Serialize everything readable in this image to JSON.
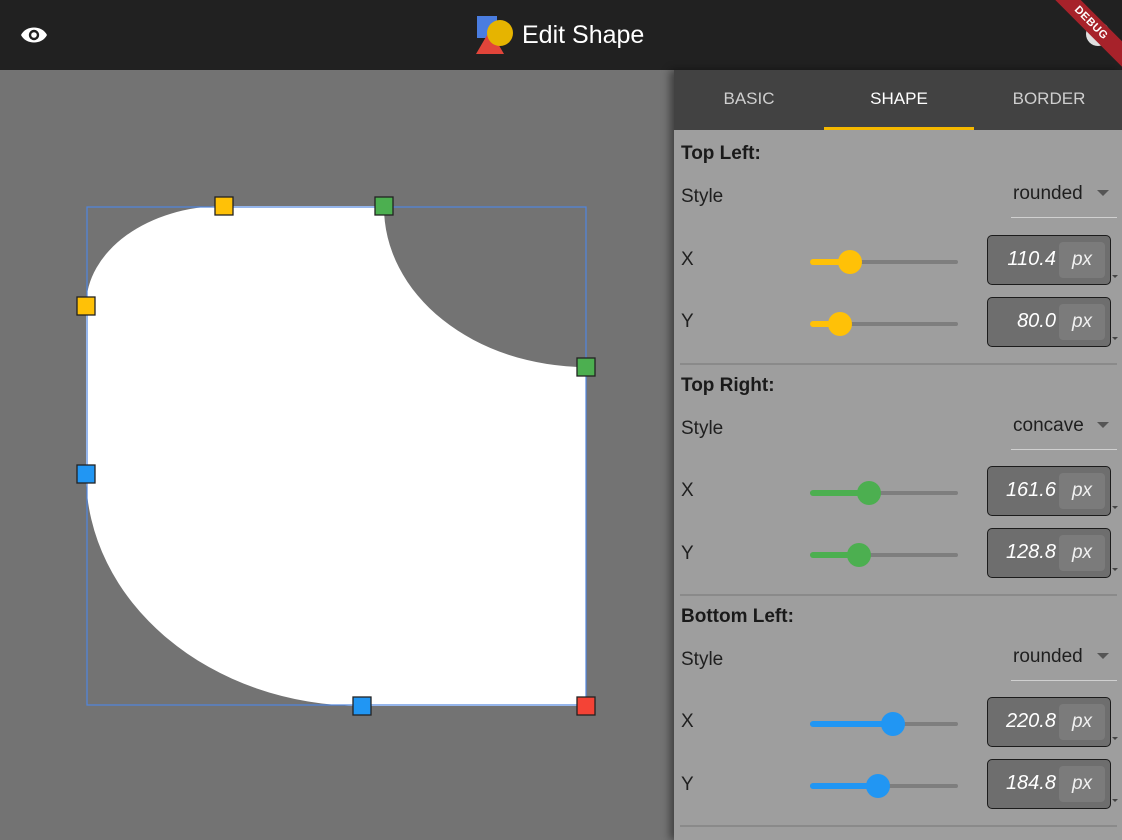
{
  "appbar": {
    "title": "Edit Shape",
    "preview_icon": "eye-icon",
    "logo_icon": "shapes-logo-icon",
    "debug_label": "DEBUG"
  },
  "tabs": [
    {
      "label": "BASIC"
    },
    {
      "label": "SHAPE"
    },
    {
      "label": "BORDER"
    }
  ],
  "active_tab": "SHAPE",
  "corners": [
    {
      "title": "Top Left:",
      "style_label": "Style",
      "style": "rounded",
      "color": "#ffc107",
      "x": {
        "label": "X",
        "value": "110.4",
        "unit": "px",
        "fraction": 0.27
      },
      "y": {
        "label": "Y",
        "value": "80.0",
        "unit": "px",
        "fraction": 0.2
      }
    },
    {
      "title": "Top Right:",
      "style_label": "Style",
      "style": "concave",
      "color": "#4caf50",
      "x": {
        "label": "X",
        "value": "161.6",
        "unit": "px",
        "fraction": 0.4
      },
      "y": {
        "label": "Y",
        "value": "128.8",
        "unit": "px",
        "fraction": 0.33
      }
    },
    {
      "title": "Bottom Left:",
      "style_label": "Style",
      "style": "rounded",
      "color": "#2196f3",
      "x": {
        "label": "X",
        "value": "220.8",
        "unit": "px",
        "fraction": 0.56
      },
      "y": {
        "label": "Y",
        "value": "184.8",
        "unit": "px",
        "fraction": 0.46
      }
    }
  ],
  "colors": {
    "appbar": "#212121",
    "canvas": "#737373",
    "panel": "#9e9e9e",
    "tab_indicator": "#f5b800",
    "bottom_right_handle": "#f44336"
  }
}
